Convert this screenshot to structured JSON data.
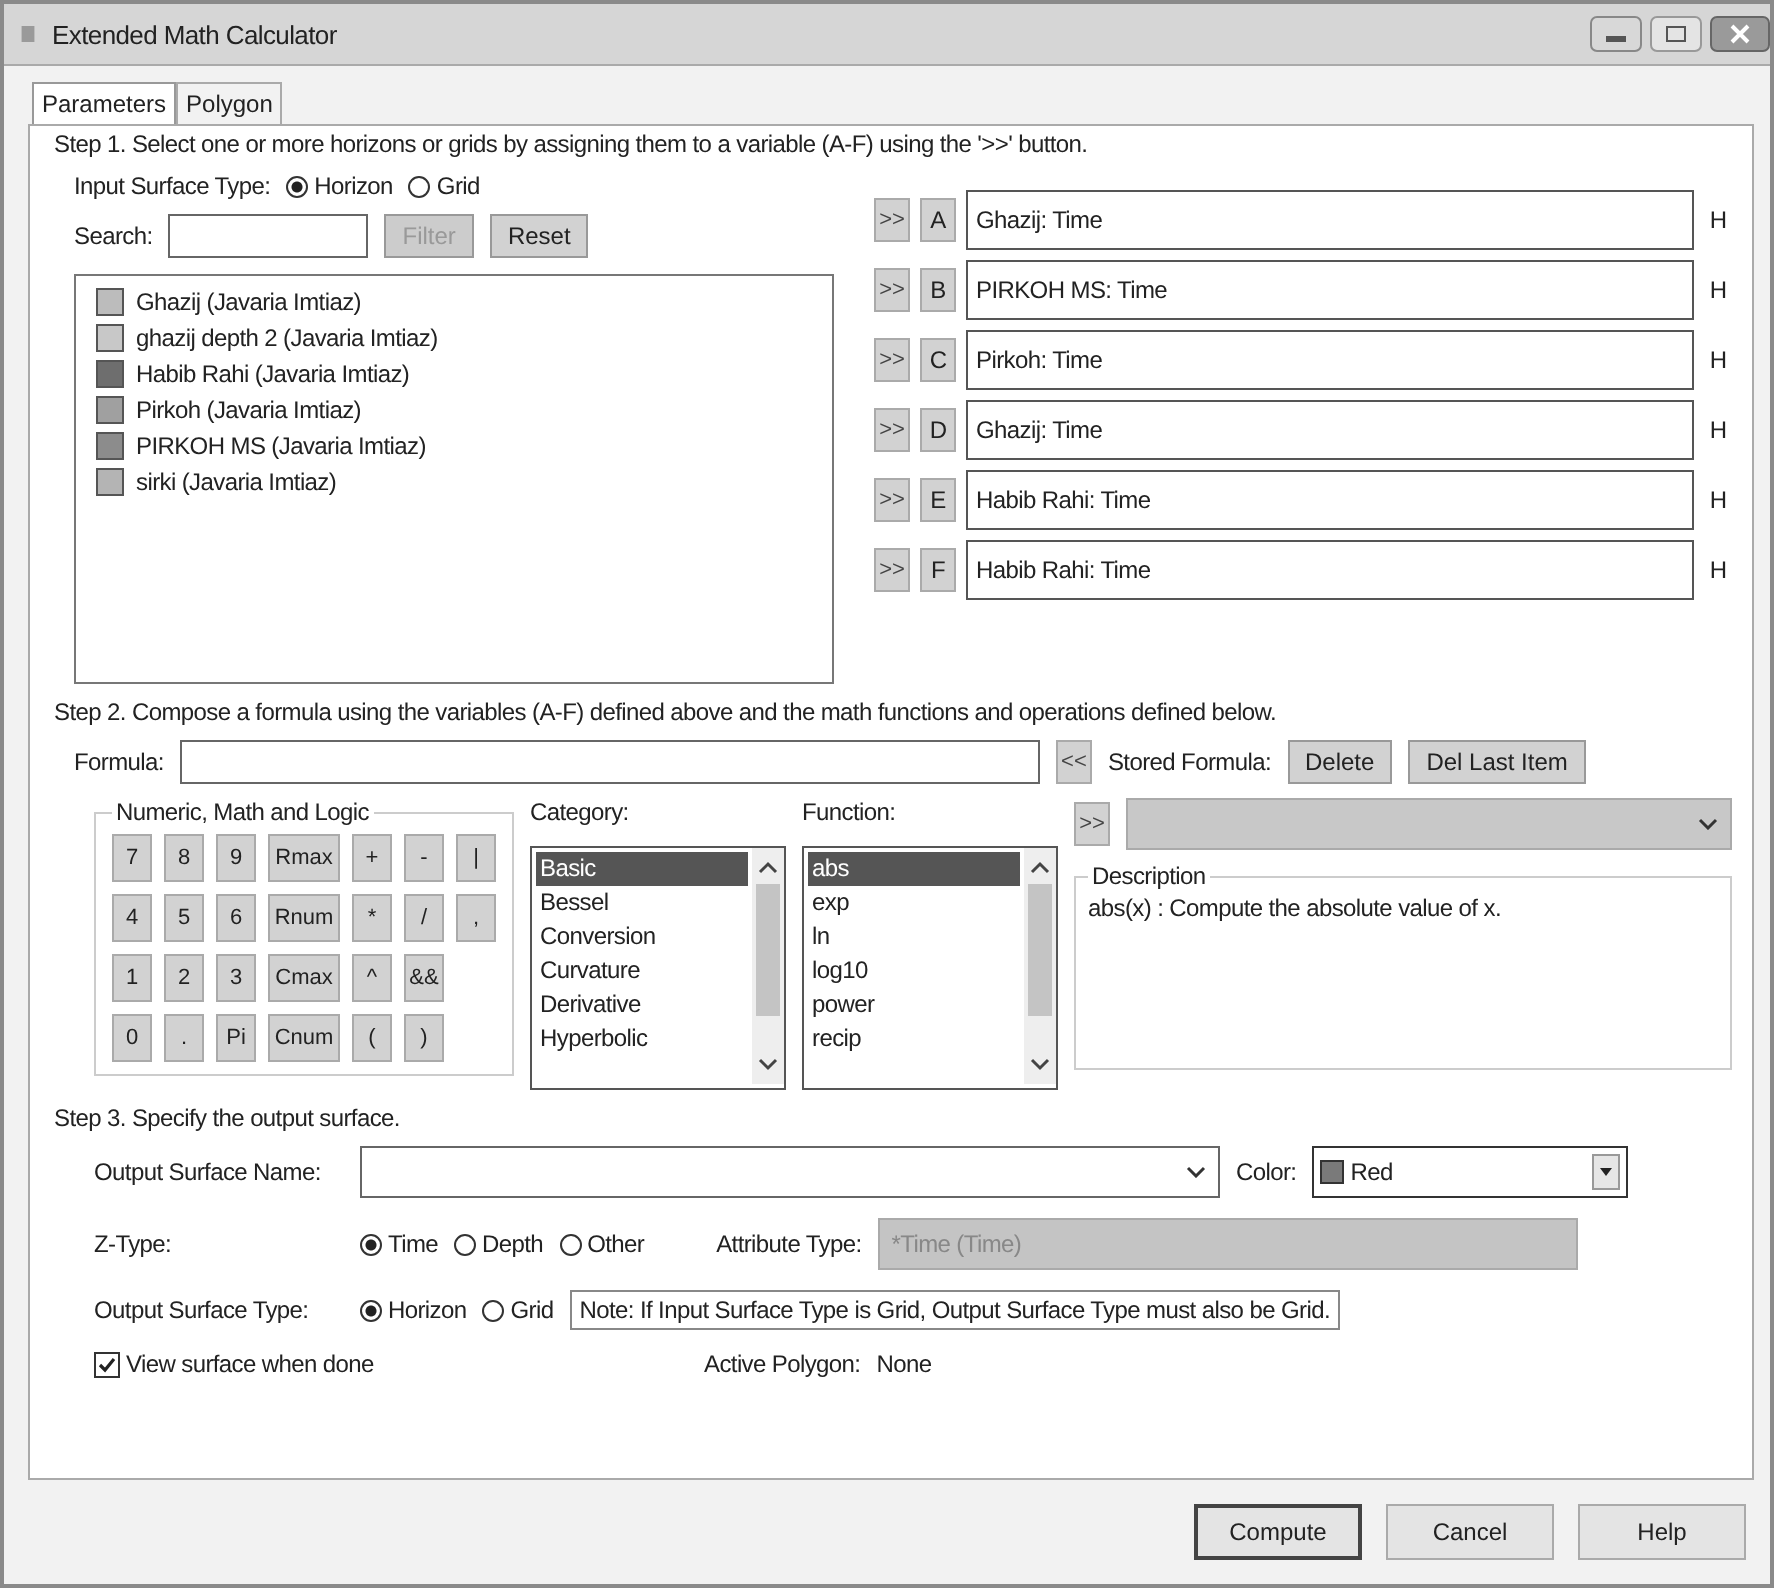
{
  "window": {
    "title": "Extended Math Calculator"
  },
  "tabs": [
    {
      "label": "Parameters",
      "selected": true
    },
    {
      "label": "Polygon",
      "selected": false
    }
  ],
  "step1": {
    "instruction": "Step 1. Select one or more horizons or grids by assigning them to a variable (A-F) using the '>>' button.",
    "input_surface_type": {
      "label": "Input Surface Type:",
      "options": [
        {
          "label": "Horizon",
          "selected": true
        },
        {
          "label": "Grid",
          "selected": false
        }
      ]
    },
    "search": {
      "label": "Search:"
    },
    "buttons": [
      {
        "label": "Filter",
        "disabled": true
      },
      {
        "label": "Reset",
        "disabled": false
      }
    ],
    "horizons": [
      {
        "name": "Ghazij (Javaria Imtiaz)",
        "color": "#bcbcbc"
      },
      {
        "name": "ghazij depth 2 (Javaria Imtiaz)",
        "color": "#c8c8c8"
      },
      {
        "name": "Habib Rahi (Javaria Imtiaz)",
        "color": "#6e6e6e"
      },
      {
        "name": "Pirkoh (Javaria Imtiaz)",
        "color": "#a0a0a0"
      },
      {
        "name": "PIRKOH MS (Javaria Imtiaz)",
        "color": "#8c8c8c"
      },
      {
        "name": "sirki (Javaria Imtiaz)",
        "color": "#b4b4b4"
      }
    ],
    "variables": [
      {
        "assign": ">>",
        "letter": "A",
        "value": "Ghazij: Time",
        "type": "H"
      },
      {
        "assign": ">>",
        "letter": "B",
        "value": "PIRKOH MS: Time",
        "type": "H"
      },
      {
        "assign": ">>",
        "letter": "C",
        "value": "Pirkoh: Time",
        "type": "H"
      },
      {
        "assign": ">>",
        "letter": "D",
        "value": "Ghazij: Time",
        "type": "H"
      },
      {
        "assign": ">>",
        "letter": "E",
        "value": "Habib Rahi: Time",
        "type": "H"
      },
      {
        "assign": ">>",
        "letter": "F",
        "value": "Habib Rahi: Time",
        "type": "H"
      }
    ]
  },
  "step2": {
    "instruction": "Step 2. Compose a formula using the variables (A-F) defined above and the math functions and operations defined below.",
    "formula_label": "Formula:",
    "recall_button": "<<",
    "stored_label": "Stored Formula:",
    "stored_buttons": [
      "Delete",
      "Del Last Item"
    ],
    "store_button": ">>",
    "keypad": {
      "title": "Numeric, Math and Logic",
      "rows": [
        [
          "7",
          "8",
          "9",
          "Rmax",
          "+",
          "-",
          "|"
        ],
        [
          "4",
          "5",
          "6",
          "Rnum",
          "*",
          "/",
          ","
        ],
        [
          "1",
          "2",
          "3",
          "Cmax",
          "^",
          "&&"
        ],
        [
          "0",
          ".",
          "Pi",
          "Cnum",
          "(",
          ")"
        ]
      ]
    },
    "category": {
      "label": "Category:",
      "items": [
        {
          "label": "Basic",
          "selected": true
        },
        {
          "label": "Bessel",
          "selected": false
        },
        {
          "label": "Conversion",
          "selected": false
        },
        {
          "label": "Curvature",
          "selected": false
        },
        {
          "label": "Derivative",
          "selected": false
        },
        {
          "label": "Hyperbolic",
          "selected": false
        }
      ]
    },
    "function": {
      "label": "Function:",
      "items": [
        {
          "label": "abs",
          "selected": true
        },
        {
          "label": "exp",
          "selected": false
        },
        {
          "label": "ln",
          "selected": false
        },
        {
          "label": "log10",
          "selected": false
        },
        {
          "label": "power",
          "selected": false
        },
        {
          "label": "recip",
          "selected": false
        }
      ]
    },
    "description": {
      "title": "Description",
      "text": "abs(x) : Compute the absolute value of x."
    }
  },
  "step3": {
    "instruction": "Step 3. Specify the output surface.",
    "name_label": "Output Surface Name:",
    "color_label": "Color:",
    "color_value": "Red",
    "z_type": {
      "label": "Z-Type:",
      "options": [
        {
          "label": "Time",
          "selected": true
        },
        {
          "label": "Depth",
          "selected": false
        },
        {
          "label": "Other",
          "selected": false
        }
      ]
    },
    "attribute": {
      "label": "Attribute Type:",
      "value": "*Time (Time)",
      "disabled": true
    },
    "output_type": {
      "label": "Output Surface Type:",
      "options": [
        {
          "label": "Horizon",
          "selected": true
        },
        {
          "label": "Grid",
          "selected": false
        }
      ]
    },
    "note": "Note: If Input Surface Type is Grid, Output Surface Type must also be Grid.",
    "view_when_done": {
      "label": "View surface when done",
      "checked": true
    },
    "active_polygon": {
      "label": "Active Polygon:",
      "value": "None"
    }
  },
  "footer_buttons": [
    {
      "label": "Compute",
      "default": true
    },
    {
      "label": "Cancel",
      "default": false
    },
    {
      "label": "Help",
      "default": false
    }
  ]
}
